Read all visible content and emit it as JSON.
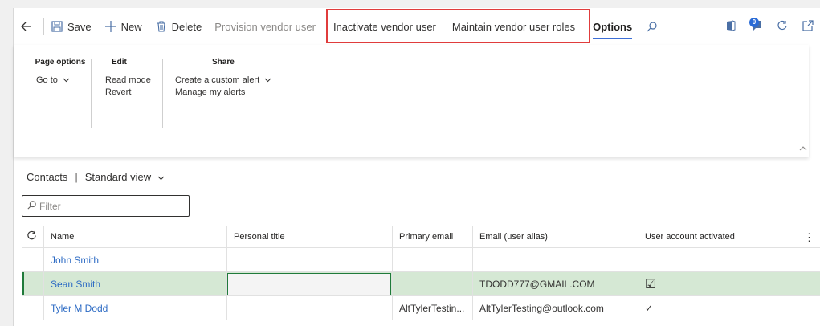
{
  "actionbar": {
    "save_label": "Save",
    "new_label": "New",
    "delete_label": "Delete",
    "provision_label": "Provision vendor user",
    "inactivate_label": "Inactivate vendor user",
    "maintain_label": "Maintain vendor user roles",
    "options_label": "Options",
    "notification_count": "0",
    "highlight_color": "#e03c3c",
    "accent_color": "#3c6ed6"
  },
  "ribbon": {
    "groups": [
      {
        "title": "Page options",
        "items": [
          "Go to"
        ]
      },
      {
        "title": "Edit",
        "items": [
          "Read mode",
          "Revert"
        ]
      },
      {
        "title": "Share",
        "items": [
          "Create a custom alert",
          "Manage my alerts"
        ]
      }
    ]
  },
  "views": {
    "title": "Contacts",
    "separator": "|",
    "view_name": "Standard view"
  },
  "filter": {
    "placeholder": "Filter"
  },
  "grid": {
    "columns": [
      "Name",
      "Personal title",
      "Primary email",
      "Email (user alias)",
      "User account activated"
    ],
    "rows": [
      {
        "name": "John Smith",
        "personal_title": "",
        "primary_email": "",
        "alias": "",
        "activated": ""
      },
      {
        "name": "Sean Smith",
        "personal_title": "",
        "primary_email": "",
        "alias": "TDODD777@GMAIL.COM",
        "activated": "☑"
      },
      {
        "name": "Tyler M Dodd",
        "personal_title": "",
        "primary_email": "AltTylerTestin...",
        "alias": "AltTylerTesting@outlook.com",
        "activated": "✓"
      }
    ],
    "selected_row_color": "#d5e8d4"
  }
}
